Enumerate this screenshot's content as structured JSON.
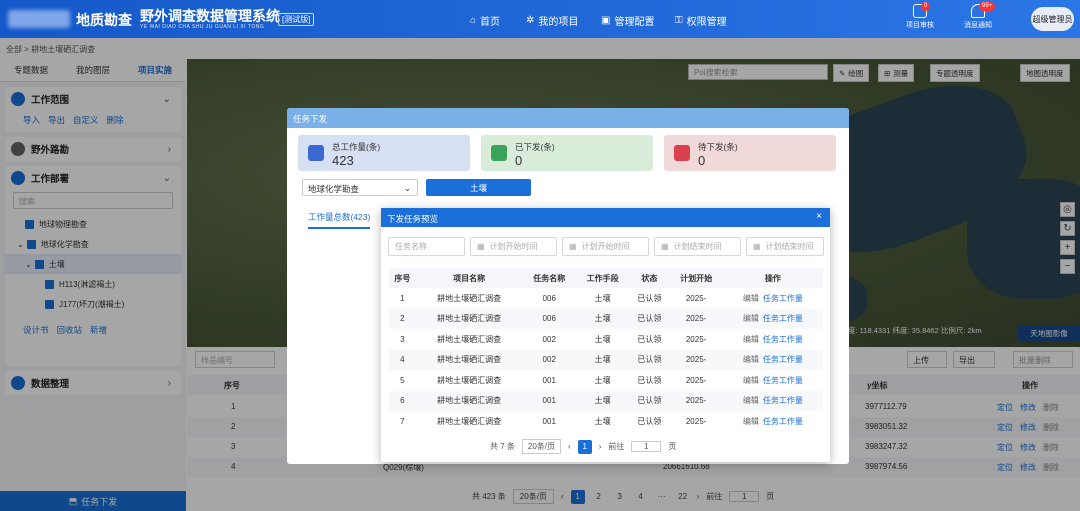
{
  "header": {
    "brand": "地质勘查",
    "title": "野外调查数据管理系统",
    "subtitle": "YE WAI DIAO CHA SHU JU GUAN LI XI TONG",
    "tag": "[测试版]",
    "nav": [
      "首页",
      "我的项目",
      "管理配置",
      "权限管理"
    ],
    "icons": [
      {
        "label": "项目审核",
        "count": "0"
      },
      {
        "label": "消息通知",
        "count": "99+"
      }
    ],
    "user": "超级管理员"
  },
  "breadcrumb": "全部  >  耕地土壤硒汇调查",
  "sidebar": {
    "tabs": [
      "专题数据",
      "我的图层",
      "项目实施"
    ],
    "work_area": {
      "title": "工作范围",
      "actions": [
        "导入",
        "导出",
        "自定义",
        "删除"
      ]
    },
    "field_route": "野外路勘",
    "deploy": {
      "title": "工作部署",
      "search_placeholder": "搜索",
      "tree": [
        "地球物理勘查",
        "地球化学勘查",
        "土壤",
        "H113(淋滤褐土)",
        "J177(坏刀(潮褐土)"
      ]
    },
    "bottom_actions": [
      "设计书",
      "回收站",
      "新增"
    ],
    "data_mgmt": "数据整理",
    "dispatch_button": "任务下发"
  },
  "map": {
    "search_placeholder": "Poi搜索检索",
    "tools": [
      "绘图",
      "测量",
      "专题透明度",
      "地图透明度"
    ],
    "coord": "度: 118.4331   纬度: 35.8462   比例尺: 2km",
    "maptype": "天地图影像"
  },
  "lower": {
    "sample_placeholder": "样品编号",
    "upload": "上传",
    "export": "导出",
    "batch_delete": "批量删除",
    "col_seq": "序号",
    "col_y": "y坐标",
    "col_op": "操作",
    "rows": [
      {
        "seq": "1",
        "y": "3977112.79"
      },
      {
        "seq": "2",
        "y": "3983051.32"
      },
      {
        "seq": "3",
        "y": "3983247.32"
      },
      {
        "seq": "4",
        "y": "3987974.56",
        "name": "Q029(棕壤)",
        "x": "20661610.68"
      }
    ],
    "ops": [
      "定位",
      "修改",
      "删除"
    ],
    "pager": {
      "total": "共 423 条",
      "size": "20条/页",
      "pages": [
        "1",
        "2",
        "3",
        "4",
        "···",
        "22"
      ],
      "goto": "前往",
      "goto_val": "1",
      "page_unit": "页"
    }
  },
  "dialog1": {
    "title": "任务下发",
    "cards": [
      {
        "label": "总工作量(条)",
        "value": "423",
        "color": "#d6e0f2",
        "icon": "#3b67d1"
      },
      {
        "label": "已下发(条)",
        "value": "0",
        "color": "#d9ecd9",
        "icon": "#3aa35a"
      },
      {
        "label": "待下发(条)",
        "value": "0",
        "color": "#f1d8d9",
        "icon": "#d9414d"
      }
    ],
    "select": "地球化学勘查",
    "button": "土壤",
    "tab": "工作量总数(423)"
  },
  "dialog2": {
    "title": "下发任务预览",
    "filters": [
      "任务名称",
      "计划开始时间",
      "计划开始时间",
      "计划结束时间",
      "计划结束时间"
    ],
    "cols": [
      "序号",
      "项目名称",
      "任务名称",
      "工作手段",
      "状态",
      "计划开始",
      "操作"
    ],
    "rows": [
      [
        "1",
        "耕地土壤硒汇调查",
        "006",
        "土壤",
        "已认领",
        "2025-"
      ],
      [
        "2",
        "耕地土壤硒汇调查",
        "006",
        "土壤",
        "已认领",
        "2025-"
      ],
      [
        "3",
        "耕地土壤硒汇调查",
        "002",
        "土壤",
        "已认领",
        "2025-"
      ],
      [
        "4",
        "耕地土壤硒汇调查",
        "002",
        "土壤",
        "已认领",
        "2025-"
      ],
      [
        "5",
        "耕地土壤硒汇调查",
        "001",
        "土壤",
        "已认领",
        "2025-"
      ],
      [
        "6",
        "耕地土壤硒汇调查",
        "001",
        "土壤",
        "已认领",
        "2025-"
      ],
      [
        "7",
        "耕地土壤硒汇调查",
        "001",
        "土壤",
        "已认领",
        "2025-"
      ]
    ],
    "op_edit": "编辑",
    "op_work": "任务工作量",
    "pager": {
      "total": "共 7 条",
      "size": "20条/页",
      "page": "1",
      "goto": "前往",
      "goto_val": "1",
      "unit": "页"
    }
  }
}
